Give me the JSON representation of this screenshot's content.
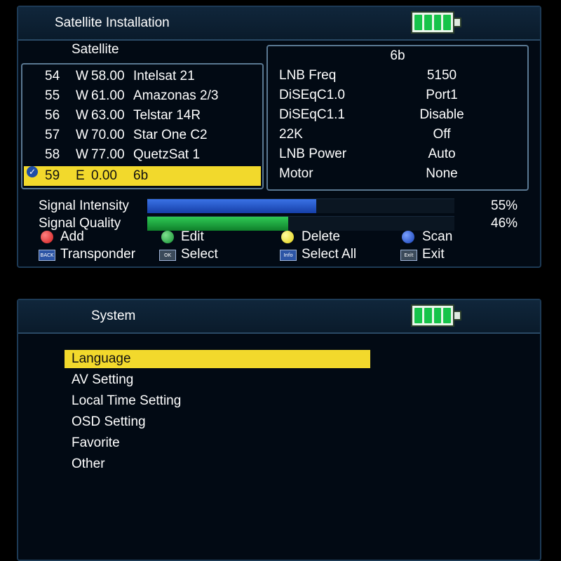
{
  "top_window": {
    "title": "Satellite Installation",
    "satellite_header": "Satellite",
    "satellites": [
      {
        "num": "54",
        "dir": "W",
        "pos": "58.00",
        "name": "Intelsat 21",
        "selected": false
      },
      {
        "num": "55",
        "dir": "W",
        "pos": "61.00",
        "name": "Amazonas 2/3",
        "selected": false
      },
      {
        "num": "56",
        "dir": "W",
        "pos": "63.00",
        "name": "Telstar 14R",
        "selected": false
      },
      {
        "num": "57",
        "dir": "W",
        "pos": "70.00",
        "name": "Star One C2",
        "selected": false
      },
      {
        "num": "58",
        "dir": "W",
        "pos": "77.00",
        "name": "QuetzSat 1",
        "selected": false
      },
      {
        "num": "59",
        "dir": "E",
        "pos": "0.00",
        "name": "6b",
        "selected": true
      }
    ],
    "details": {
      "title": "6b",
      "rows": [
        {
          "label": "LNB Freq",
          "value": "5150"
        },
        {
          "label": "DiSEqC1.0",
          "value": "Port1"
        },
        {
          "label": "DiSEqC1.1",
          "value": "Disable"
        },
        {
          "label": "22K",
          "value": "Off"
        },
        {
          "label": "LNB Power",
          "value": "Auto"
        },
        {
          "label": "Motor",
          "value": "None"
        }
      ]
    },
    "signal": {
      "intensity_label": "Signal Intensity",
      "intensity_value": "55%",
      "intensity_fraction": 0.55,
      "quality_label": "Signal Quality",
      "quality_value": "46%",
      "quality_fraction": 0.46
    },
    "legend": {
      "add": "Add",
      "edit": "Edit",
      "delete": "Delete",
      "scan": "Scan",
      "transponder": "Transponder",
      "select": "Select",
      "select_all": "Select All",
      "exit": "Exit",
      "key_back": "BACK",
      "key_ok": "OK",
      "key_info": "Info",
      "key_exit": "Exit"
    }
  },
  "bottom_window": {
    "title": "System",
    "menu": [
      "Language",
      "AV Setting",
      "Local Time Setting",
      "OSD Setting",
      "Favorite",
      "Other"
    ],
    "selected_index": 0
  },
  "colors": {
    "highlight": "#f2d92c",
    "intensity_bar": "#1f53c8",
    "quality_bar": "#15a13a",
    "battery": "#16c34a",
    "red_button": "#e03030",
    "green_button": "#1fa83a",
    "yellow_button": "#f0e020",
    "blue_button": "#1d4fc4"
  },
  "icons": [
    "battery-icon",
    "check-icon",
    "back-key-icon",
    "ok-key-icon",
    "info-key-icon",
    "exit-key-icon"
  ]
}
